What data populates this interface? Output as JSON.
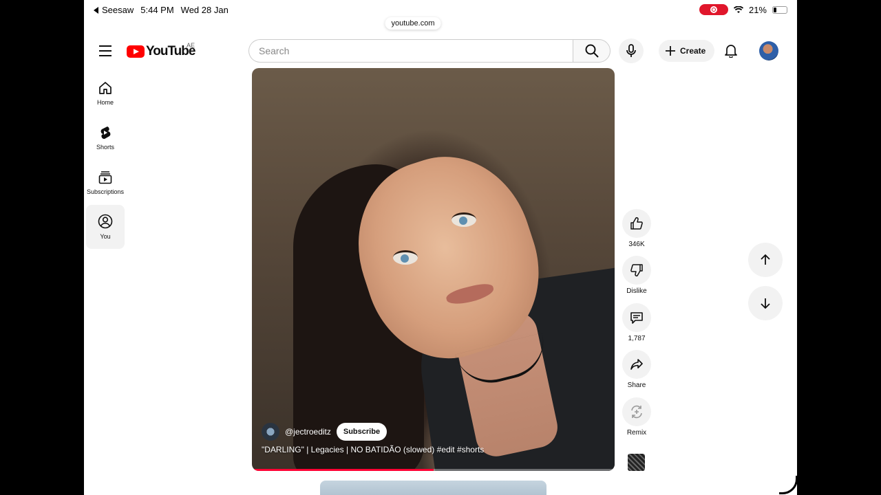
{
  "status_bar": {
    "back_app": "Seesaw",
    "time": "5:44 PM",
    "date": "Wed 28 Jan",
    "battery": "21%"
  },
  "url": "youtube.com",
  "header": {
    "logo_text": "YouTube",
    "region": "AE",
    "search_placeholder": "Search",
    "create_label": "Create"
  },
  "sidebar": {
    "items": [
      {
        "label": "Home",
        "icon": "home-icon"
      },
      {
        "label": "Shorts",
        "icon": "shorts-icon"
      },
      {
        "label": "Subscriptions",
        "icon": "subscriptions-icon"
      },
      {
        "label": "You",
        "icon": "account-icon"
      }
    ]
  },
  "video": {
    "channel": "@jectroeditz",
    "subscribe_label": "Subscribe",
    "title": "\"DARLING\" | Legacies | NO BATIDÃO (slowed) #edit #shorts",
    "progress": 0.5
  },
  "actions": {
    "like_count": "346K",
    "dislike_label": "Dislike",
    "comment_count": "1,787",
    "share_label": "Share",
    "remix_label": "Remix"
  },
  "colors": {
    "brand_red": "#ff0000",
    "progress_red": "#ff0033"
  }
}
